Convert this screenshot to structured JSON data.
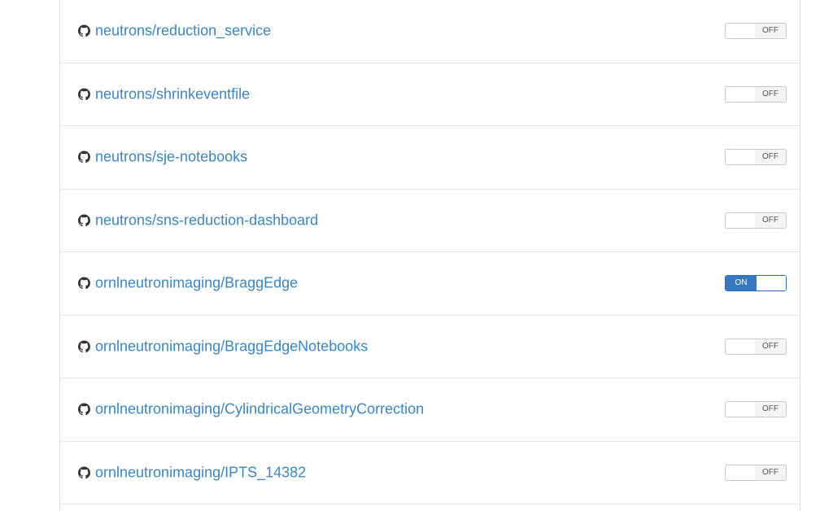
{
  "repositories": [
    {
      "name": "neutrons/reduction_service",
      "toggle": "OFF"
    },
    {
      "name": "neutrons/shrinkeventfile",
      "toggle": "OFF"
    },
    {
      "name": "neutrons/sje-notebooks",
      "toggle": "OFF"
    },
    {
      "name": "neutrons/sns-reduction-dashboard",
      "toggle": "OFF"
    },
    {
      "name": "ornlneutronimaging/BraggEdge",
      "toggle": "ON"
    },
    {
      "name": "ornlneutronimaging/BraggEdgeNotebooks",
      "toggle": "OFF"
    },
    {
      "name": "ornlneutronimaging/CylindricalGeometryCorrection",
      "toggle": "OFF"
    },
    {
      "name": "ornlneutronimaging/IPTS_14382",
      "toggle": "OFF"
    }
  ],
  "colors": {
    "link": "#3c86c4",
    "toggle_on": "#3479c2"
  },
  "icons": {
    "repo": "github-icon"
  }
}
